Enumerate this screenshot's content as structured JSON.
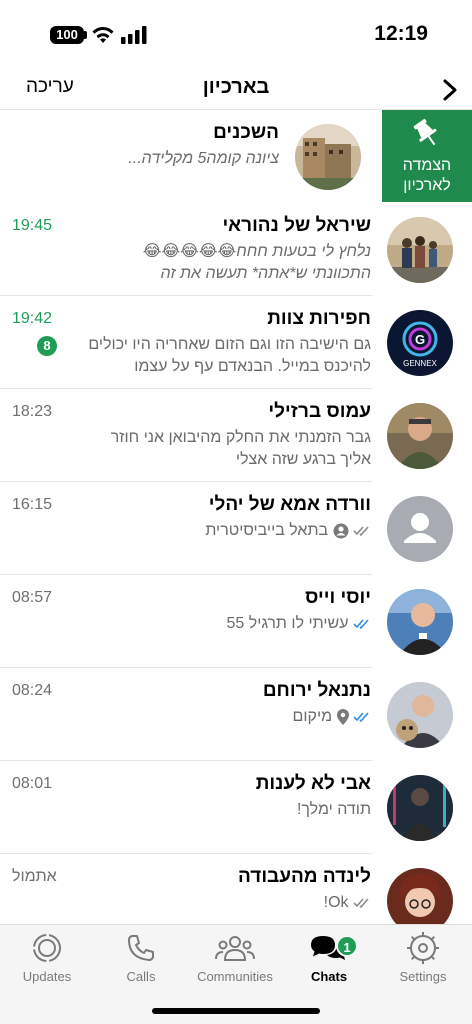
{
  "status_bar": {
    "battery": "100",
    "time": "12:19"
  },
  "nav": {
    "edit_label": "עריכה",
    "title": "בארכיון"
  },
  "unarchive": {
    "line1": "הצמדה",
    "line2": "לארכיון"
  },
  "chats": [
    {
      "name": "השכנים",
      "preview": "ציונה קומה5 מקלידה...",
      "time": "",
      "unread": "",
      "italic": true
    },
    {
      "name": "שיראל של נהוראי",
      "preview1": "נלחץ לי בטעות חחח😂😂😂😂😂",
      "preview2": "התכוונתי ש*אתה* תעשה את זה",
      "time": "19:45",
      "unread": ""
    },
    {
      "name": "חפירות צוות",
      "preview1": "גם הישיבה הזו וגם הזום שאחריה היו יכולים",
      "preview2": "להיכנס במייל. הבנאדם עף על עצמו",
      "time": "19:42",
      "unread": "8"
    },
    {
      "name": "עמוס ברזילי",
      "preview1": "גבר הזמנתי את החלק מהיבואן אני חוזר",
      "preview2": "אליך ברגע שזה אצלי",
      "time": "18:23",
      "unread": ""
    },
    {
      "name": "וורדה אמא של יהלי",
      "preview": "בתאל בייביסיטרית",
      "time": "16:15",
      "unread": ""
    },
    {
      "name": "יוסי וייס",
      "preview": "עשיתי לו תרגיל 55",
      "time": "08:57",
      "unread": ""
    },
    {
      "name": "נתנאל ירוחם",
      "preview": "מיקום",
      "time": "08:24",
      "unread": ""
    },
    {
      "name": "אבי לא לענות",
      "preview": "תודה ימלך!",
      "time": "08:01",
      "unread": ""
    },
    {
      "name": "לינדה מהעבודה",
      "preview": "Ok!",
      "time": "אתמול",
      "unread": ""
    }
  ],
  "tabs": [
    {
      "label": "Updates"
    },
    {
      "label": "Calls"
    },
    {
      "label": "Communities"
    },
    {
      "label": "Chats",
      "badge": "1"
    },
    {
      "label": "Settings"
    }
  ],
  "colors": {
    "accent": "#1f9d55",
    "archive_green": "#1f8a4c"
  }
}
